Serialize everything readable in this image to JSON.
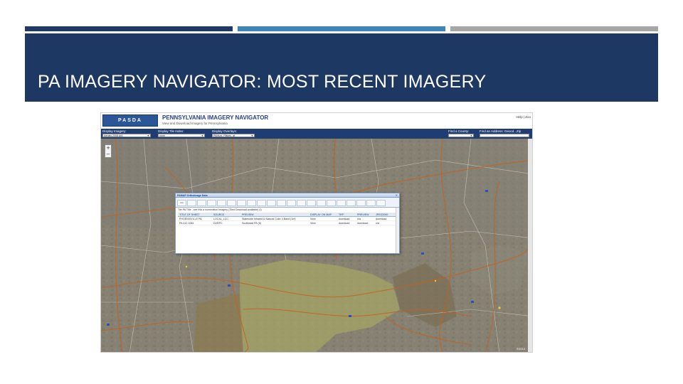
{
  "slide": {
    "title": "PA IMAGERY NAVIGATOR: MOST RECENT IMAGERY",
    "colors": {
      "header_bg": "#1e3864",
      "accent_1": "#1f3864",
      "accent_2": "#3d85b8",
      "accent_3": "#a6a6a6"
    }
  },
  "app": {
    "logo_text": "PASDA",
    "title": "PENNSYLVANIA IMAGERY NAVIGATOR",
    "subtitle": "View and Download Imagery for Pennsylvania",
    "help_link": "Help | Zoo"
  },
  "toolbar": {
    "display_imagery": {
      "label": "Display Imagery:",
      "value": "Aerials 2008 AIA"
    },
    "display_tile_index": {
      "label": "Display Tile Index:",
      "value": "none"
    },
    "display_overlays": {
      "label": "Display Overlays:",
      "value": "PAMuni, Places, at"
    },
    "find_county": {
      "label": "Find a County:",
      "value": ""
    },
    "find_address": {
      "label": "Find an Address: Geocd...Zip",
      "value": ""
    }
  },
  "map": {
    "zoom_in": "+",
    "zoom_out": "−",
    "attribution": "©2012"
  },
  "popup": {
    "title": "PAMAP Orthoimage Data",
    "close": "×",
    "tabs": [
      "AIA",
      "",
      "",
      "",
      "",
      "",
      "",
      "",
      "",
      "",
      "",
      "",
      "",
      "",
      "",
      "",
      "",
      "",
      "",
      "",
      ""
    ],
    "note": "Tile PA Title - see this a numeration Imagery (Tiled Download available) (I)",
    "columns": [
      "TITLE OF SHEET",
      "SOURCE",
      "PREVIEW",
      "DISPLAY ON MAP",
      "TIFF",
      "PREVIEW",
      "JPEG2000"
    ],
    "rows": [
      [
        "PHOENIXVILLE PA",
        "LOCAL_LCC",
        "Statewide Infrared & Natural Color 4 Band (1m)",
        "View",
        "download",
        "n/a",
        "download"
      ],
      [
        "PA 410 1084",
        "DVRPC",
        "Southeast PA (ft)",
        "View",
        "download",
        "download",
        "n/a"
      ]
    ]
  }
}
